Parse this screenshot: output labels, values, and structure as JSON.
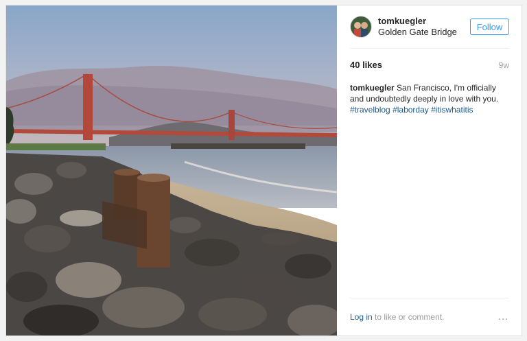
{
  "post": {
    "username": "tomkuegler",
    "location": "Golden Gate Bridge",
    "follow_label": "Follow",
    "likes": "40 likes",
    "time_ago": "9w",
    "caption": {
      "username": "tomkuegler",
      "text": "San Francisco, I'm officially and undoubtedly deeply in love with you.",
      "hashtags": [
        "#travelblog",
        "#laborday",
        "#itiswhatitis"
      ]
    }
  },
  "footer": {
    "login_link": "Log in",
    "login_suffix": "to like or comment.",
    "more_icon": "more-options-icon"
  },
  "colors": {
    "link": "#3897f0",
    "hashtag": "#1e5a8a",
    "text": "#262626",
    "muted": "#999999"
  }
}
